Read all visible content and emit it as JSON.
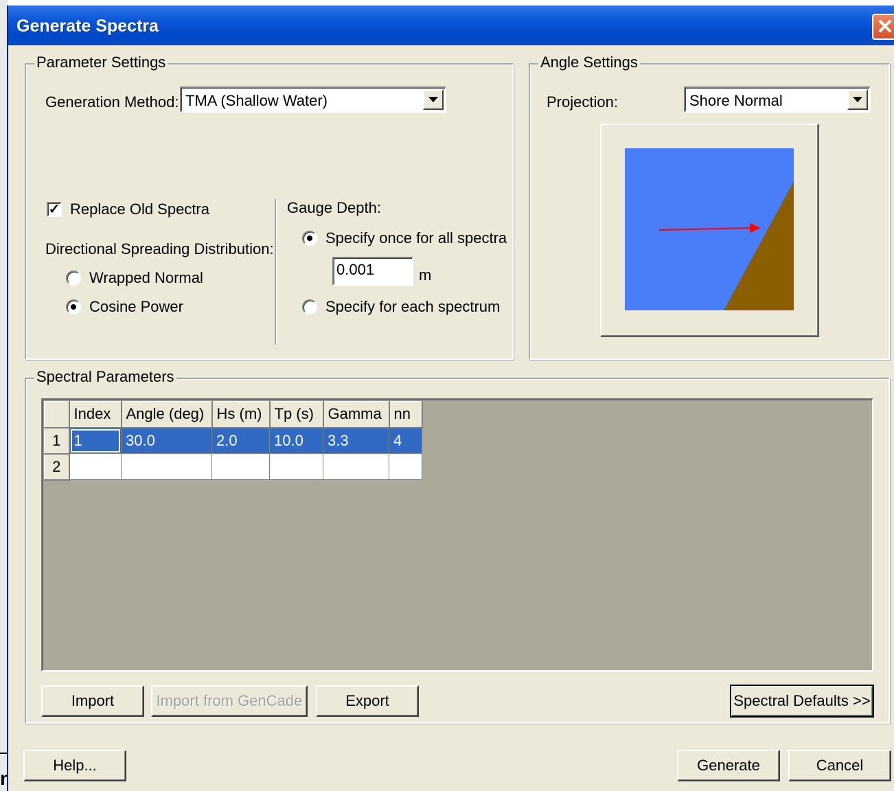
{
  "window": {
    "title": "Generate Spectra",
    "close_glyph": "✕"
  },
  "parameter_settings": {
    "group_label": "Parameter Settings",
    "generation_method_label": "Generation Method:",
    "generation_method_value": "TMA (Shallow Water)",
    "replace_old_spectra_label": "Replace Old Spectra",
    "replace_old_spectra_checked": true,
    "directional_spreading_label": "Directional Spreading Distribution:",
    "spreading_options": [
      {
        "label": "Wrapped Normal",
        "selected": false
      },
      {
        "label": "Cosine Power",
        "selected": true
      }
    ],
    "gauge_depth_label": "Gauge Depth:",
    "gauge_options": [
      {
        "label": "Specify once for all spectra",
        "selected": true
      },
      {
        "label": "Specify for each spectrum",
        "selected": false
      }
    ],
    "gauge_depth_value": "0.001",
    "gauge_depth_unit": "m"
  },
  "angle_settings": {
    "group_label": "Angle Settings",
    "projection_label": "Projection:",
    "projection_value": "Shore Normal",
    "preview_colors": {
      "water": "#4a7ef8",
      "land": "#8b5f00",
      "arrow": "#ff0000"
    }
  },
  "spectral_parameters": {
    "group_label": "Spectral Parameters",
    "columns": [
      "Index",
      "Angle (deg)",
      "Hs (m)",
      "Tp (s)",
      "Gamma",
      "nn"
    ],
    "rows": [
      {
        "header": "1",
        "cells": [
          "1",
          "30.0",
          "2.0",
          "10.0",
          "3.3",
          "4"
        ],
        "selected": true
      },
      {
        "header": "2",
        "cells": [
          "",
          "",
          "",
          "",
          "",
          ""
        ],
        "selected": false
      }
    ],
    "buttons": {
      "import": "Import",
      "import_gencade": "Import from GenCade",
      "export": "Export",
      "spectral_defaults": "Spectral Defaults >>"
    }
  },
  "footer": {
    "help": "Help...",
    "generate": "Generate",
    "cancel": "Cancel"
  },
  "stray_text": "n"
}
